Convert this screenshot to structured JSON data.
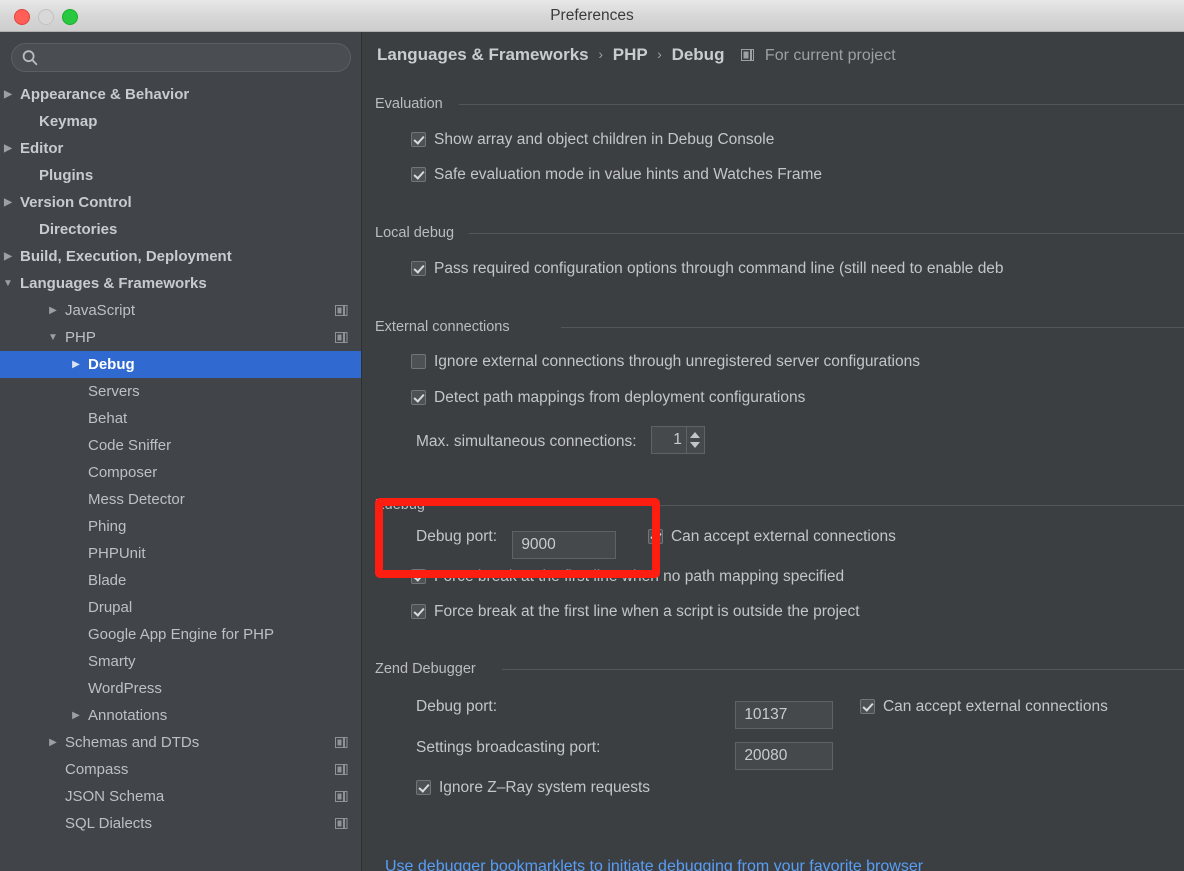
{
  "window": {
    "title": "Preferences",
    "traffic_lights": [
      "close",
      "minimize",
      "maximize"
    ]
  },
  "sidebar": {
    "search": {
      "value": "",
      "placeholder": ""
    },
    "items": [
      {
        "label": "Appearance & Behavior",
        "indent": 20,
        "arrow": "right",
        "bold": true,
        "module_icon": false,
        "selected": false
      },
      {
        "label": "Keymap",
        "indent": 39,
        "arrow": "none",
        "bold": true,
        "module_icon": false,
        "selected": false
      },
      {
        "label": "Editor",
        "indent": 20,
        "arrow": "right",
        "bold": true,
        "module_icon": false,
        "selected": false
      },
      {
        "label": "Plugins",
        "indent": 39,
        "arrow": "none",
        "bold": true,
        "module_icon": false,
        "selected": false
      },
      {
        "label": "Version Control",
        "indent": 20,
        "arrow": "right",
        "bold": true,
        "module_icon": false,
        "selected": false
      },
      {
        "label": "Directories",
        "indent": 39,
        "arrow": "none",
        "bold": true,
        "module_icon": false,
        "selected": false
      },
      {
        "label": "Build, Execution, Deployment",
        "indent": 20,
        "arrow": "right",
        "bold": true,
        "module_icon": false,
        "selected": false
      },
      {
        "label": "Languages & Frameworks",
        "indent": 20,
        "arrow": "down",
        "bold": true,
        "module_icon": false,
        "selected": false
      },
      {
        "label": "JavaScript",
        "indent": 65,
        "arrow": "right",
        "bold": false,
        "module_icon": true,
        "selected": false
      },
      {
        "label": "PHP",
        "indent": 65,
        "arrow": "down",
        "bold": false,
        "module_icon": true,
        "selected": false
      },
      {
        "label": "Debug",
        "indent": 88,
        "arrow": "right",
        "bold": false,
        "module_icon": false,
        "selected": true
      },
      {
        "label": "Servers",
        "indent": 88,
        "arrow": "none",
        "bold": false,
        "module_icon": false,
        "selected": false
      },
      {
        "label": "Behat",
        "indent": 88,
        "arrow": "none",
        "bold": false,
        "module_icon": false,
        "selected": false
      },
      {
        "label": "Code Sniffer",
        "indent": 88,
        "arrow": "none",
        "bold": false,
        "module_icon": false,
        "selected": false
      },
      {
        "label": "Composer",
        "indent": 88,
        "arrow": "none",
        "bold": false,
        "module_icon": false,
        "selected": false
      },
      {
        "label": "Mess Detector",
        "indent": 88,
        "arrow": "none",
        "bold": false,
        "module_icon": false,
        "selected": false
      },
      {
        "label": "Phing",
        "indent": 88,
        "arrow": "none",
        "bold": false,
        "module_icon": false,
        "selected": false
      },
      {
        "label": "PHPUnit",
        "indent": 88,
        "arrow": "none",
        "bold": false,
        "module_icon": false,
        "selected": false
      },
      {
        "label": "Blade",
        "indent": 88,
        "arrow": "none",
        "bold": false,
        "module_icon": false,
        "selected": false
      },
      {
        "label": "Drupal",
        "indent": 88,
        "arrow": "none",
        "bold": false,
        "module_icon": false,
        "selected": false
      },
      {
        "label": "Google App Engine for PHP",
        "indent": 88,
        "arrow": "none",
        "bold": false,
        "module_icon": false,
        "selected": false
      },
      {
        "label": "Smarty",
        "indent": 88,
        "arrow": "none",
        "bold": false,
        "module_icon": false,
        "selected": false
      },
      {
        "label": "WordPress",
        "indent": 88,
        "arrow": "none",
        "bold": false,
        "module_icon": false,
        "selected": false
      },
      {
        "label": "Annotations",
        "indent": 88,
        "arrow": "right",
        "bold": false,
        "module_icon": false,
        "selected": false
      },
      {
        "label": "Schemas and DTDs",
        "indent": 65,
        "arrow": "right",
        "bold": false,
        "module_icon": true,
        "selected": false
      },
      {
        "label": "Compass",
        "indent": 65,
        "arrow": "none",
        "bold": false,
        "module_icon": true,
        "selected": false
      },
      {
        "label": "JSON Schema",
        "indent": 65,
        "arrow": "none",
        "bold": false,
        "module_icon": true,
        "selected": false
      },
      {
        "label": "SQL Dialects",
        "indent": 65,
        "arrow": "none",
        "bold": false,
        "module_icon": true,
        "selected": false
      }
    ]
  },
  "main": {
    "breadcrumb": {
      "part1": "Languages & Frameworks",
      "part2": "PHP",
      "part3": "Debug",
      "separator": "›",
      "scope_label": "For current project",
      "scope_icon": "module-scope-icon"
    },
    "sections": {
      "evaluation": {
        "title": "Evaluation",
        "items": [
          {
            "label": "Show array and object children in Debug Console",
            "checked": true
          },
          {
            "label": "Safe evaluation mode in value hints and Watches Frame",
            "checked": true
          }
        ]
      },
      "local_debug": {
        "title": "Local debug",
        "items": [
          {
            "label": "Pass required configuration options through command line (still need to enable deb",
            "checked": true
          }
        ]
      },
      "external_connections": {
        "title": "External connections",
        "items": [
          {
            "label": "Ignore external connections through unregistered server configurations",
            "checked": false
          },
          {
            "label": "Detect path mappings from deployment configurations",
            "checked": true
          }
        ],
        "max_connections_label": "Max. simultaneous connections:",
        "max_connections_value": "1"
      },
      "xdebug": {
        "title": "Xdebug",
        "debug_port_label": "Debug port:",
        "debug_port_value": "9000",
        "can_accept_label": "Can accept external connections",
        "can_accept_checked": true,
        "items": [
          {
            "label": "Force break at the first line when no path mapping specified",
            "checked": true
          },
          {
            "label": "Force break at the first line when a script is outside the project",
            "checked": true
          }
        ]
      },
      "zend_debugger": {
        "title": "Zend Debugger",
        "debug_port_label": "Debug port:",
        "debug_port_value": "10137",
        "can_accept_label": "Can accept external connections",
        "can_accept_checked": true,
        "broadcast_label": "Settings broadcasting port:",
        "broadcast_value": "20080",
        "ignore_zray_label": "Ignore Z–Ray system requests",
        "ignore_zray_checked": true
      }
    },
    "bookmarklet_link": "Use debugger bookmarklets to initiate debugging from your favorite browser"
  },
  "annotation": {
    "color": "#fe1d11",
    "shape": "rectangle-highlight"
  },
  "colors": {
    "sidebar_bg": "#414549",
    "panel_bg": "#3c3f41",
    "selection_blue": "#3069cf",
    "link_blue": "#589df6",
    "text": "#c2c6ca",
    "annotation_red": "#fe1d11"
  }
}
